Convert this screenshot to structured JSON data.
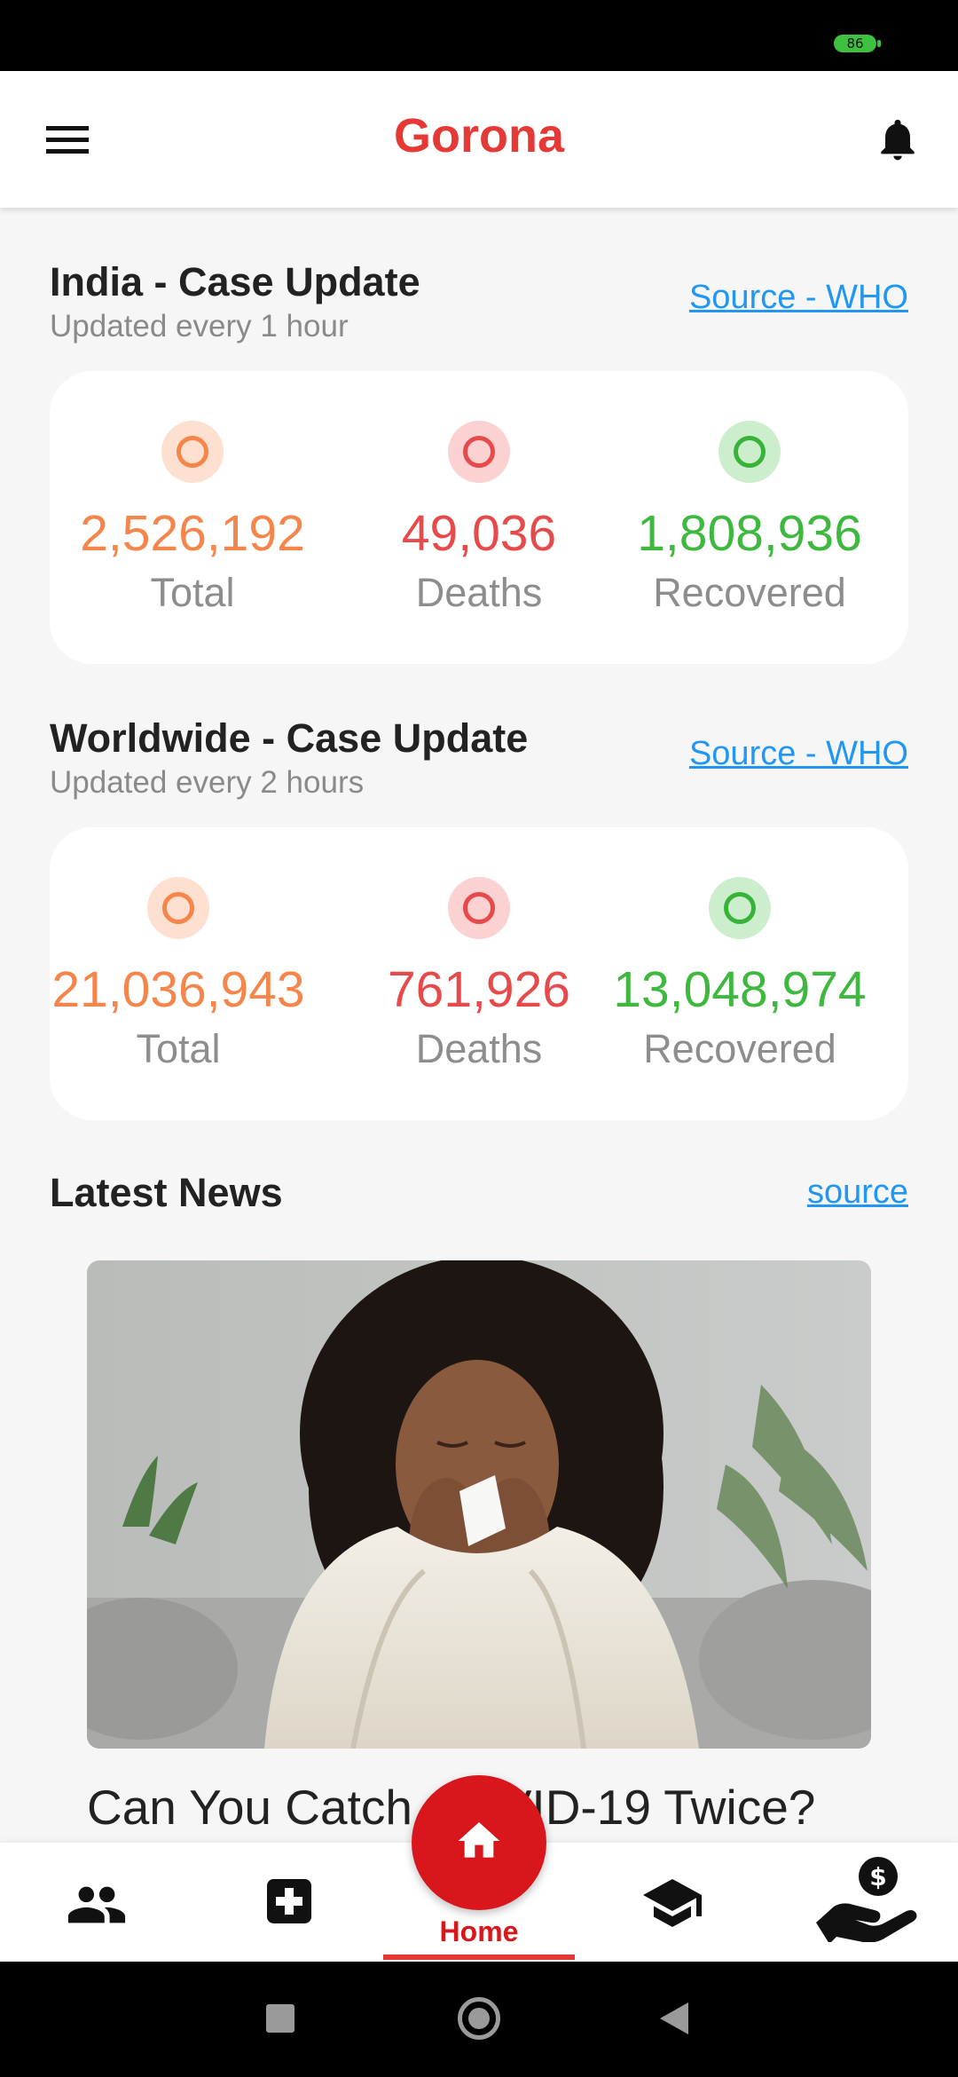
{
  "status_bar": {
    "battery": "86"
  },
  "app_bar": {
    "title": "Gorona",
    "title_color": "#e53935",
    "menu_icon": "menu-icon",
    "bell_icon": "bell-icon"
  },
  "india": {
    "title": "India - Case Update",
    "subtitle": "Updated every 1 hour",
    "source_label": "Source - WHO",
    "stats": [
      {
        "value": "2,526,192",
        "label": "Total"
      },
      {
        "value": "49,036",
        "label": "Deaths"
      },
      {
        "value": "1,808,936",
        "label": "Recovered"
      }
    ]
  },
  "world": {
    "title": "Worldwide - Case Update",
    "subtitle": "Updated every 2 hours",
    "source_label": "Source - WHO",
    "stats": [
      {
        "value": "21,036,943",
        "label": "Total"
      },
      {
        "value": "761,926",
        "label": "Deaths"
      },
      {
        "value": "13,048,974",
        "label": "Recovered"
      }
    ]
  },
  "news": {
    "title": "Latest News",
    "source_label": "source",
    "headline": "Can You Catch COVID-19 Twice?"
  },
  "bottom_nav": {
    "items": [
      {
        "icon": "people-icon"
      },
      {
        "icon": "medical-cross-icon"
      },
      {
        "icon": "home-icon",
        "label": "Home"
      },
      {
        "icon": "graduation-cap-icon"
      },
      {
        "icon": "donate-hand-icon"
      }
    ]
  },
  "colors": {
    "total": "#f4864c",
    "deaths": "#e64a4a",
    "recovered": "#3fb83f",
    "link": "#2196f3",
    "accent": "#d8161b"
  }
}
